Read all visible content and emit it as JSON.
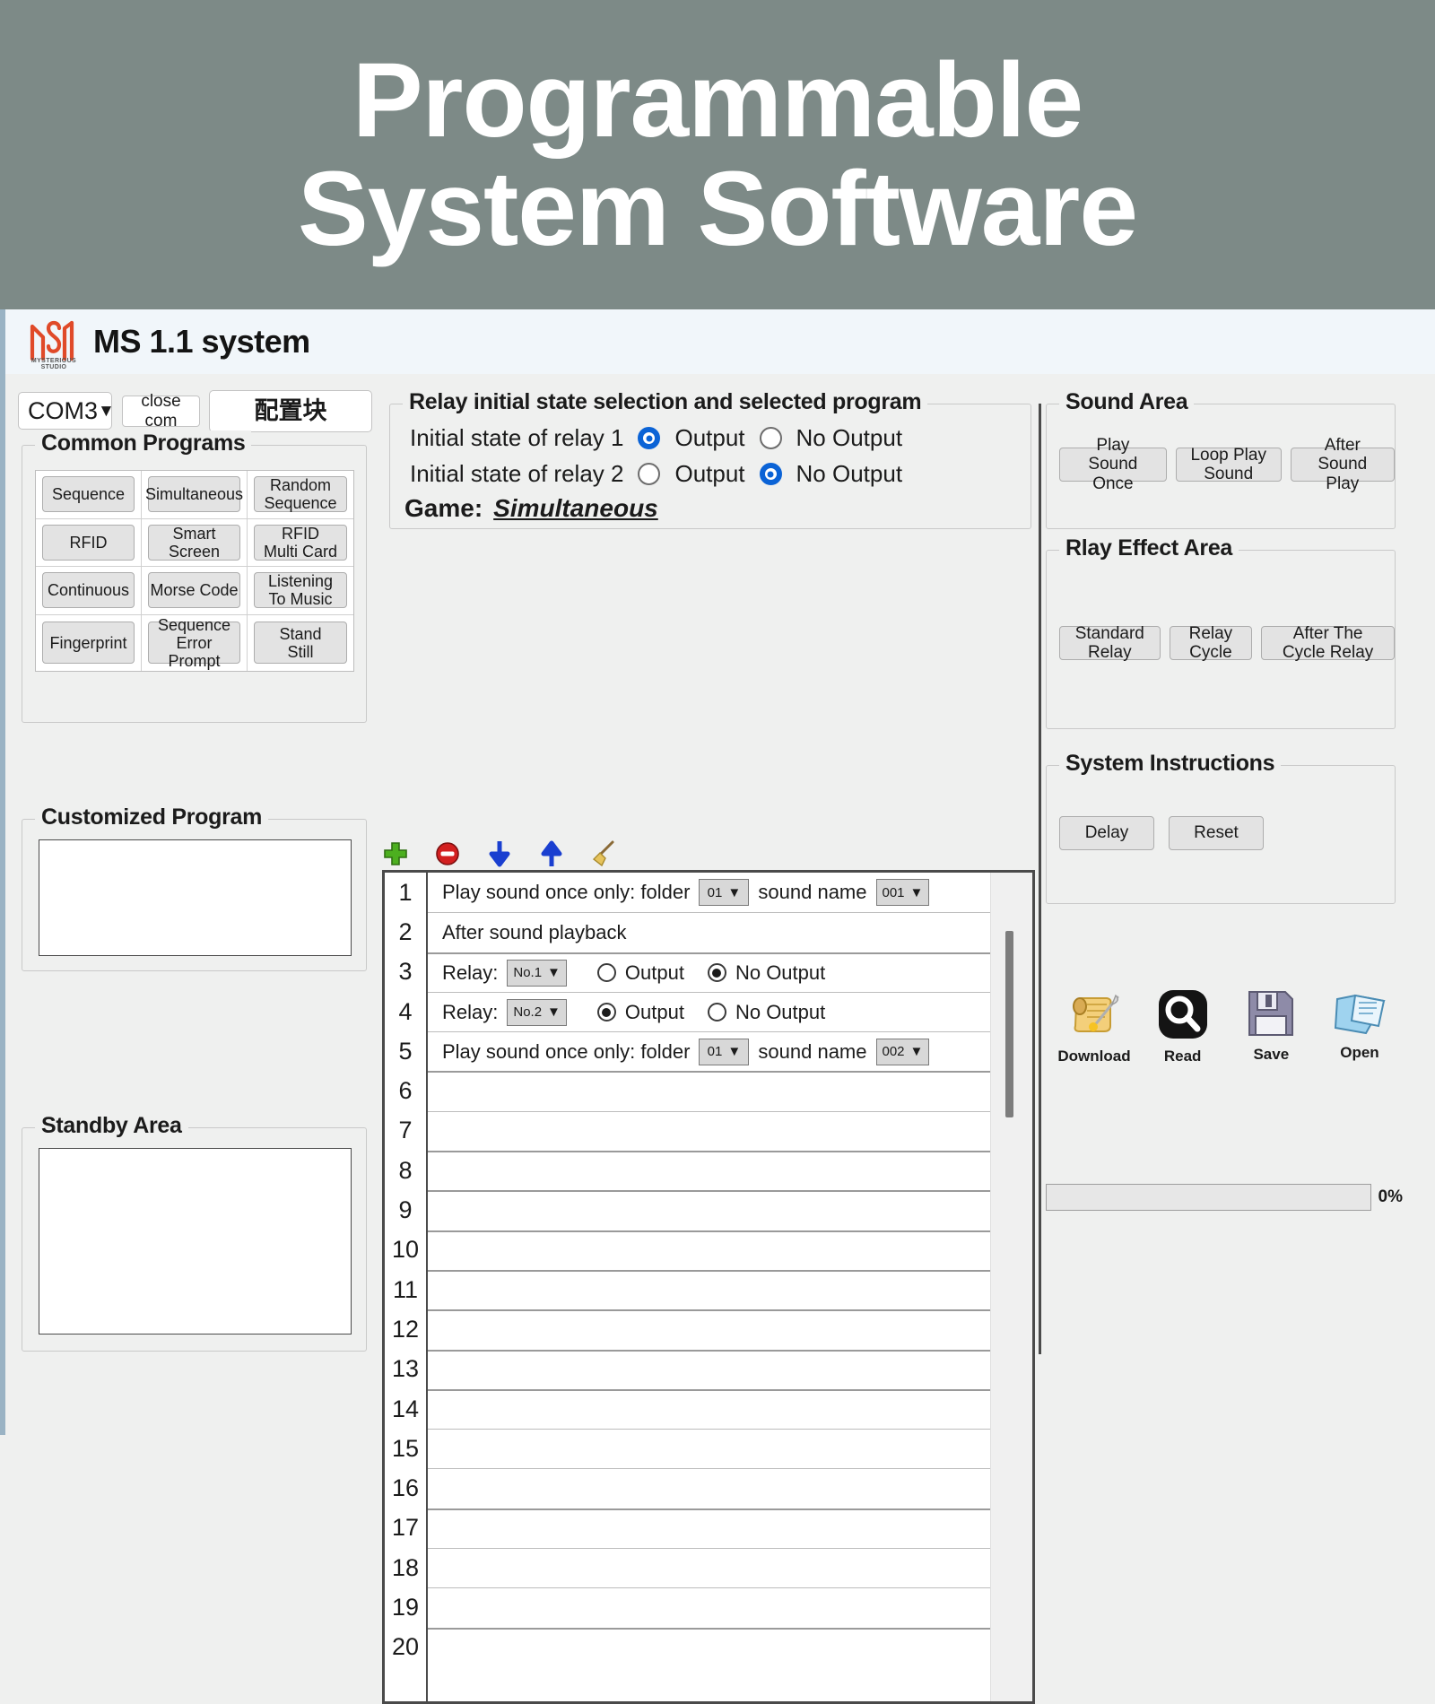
{
  "banner": {
    "line1": "Programmable",
    "line2": "System Software",
    "bg_color": "#7d8a87"
  },
  "titlebar": {
    "app_title": "MS 1.1 system",
    "logo_caption": "MYSTERIOUS STUDIO",
    "logo_color": "#e04a29"
  },
  "top_controls": {
    "com_port": "COM3",
    "com_caret": "▼",
    "close_com_label": "close com",
    "config_label": "配置块"
  },
  "common_programs": {
    "legend": "Common Programs",
    "buttons": [
      "Sequence",
      "Simultaneous",
      "Random\nSequence",
      "RFID",
      "Smart\nScreen",
      "RFID\nMulti Card",
      "Continuous",
      "Morse Code",
      "Listening\nTo Music",
      "Fingerprint",
      "Sequence\nError Prompt",
      "Stand\nStill"
    ]
  },
  "customized_program": {
    "legend": "Customized Program",
    "content": ""
  },
  "standby_area": {
    "legend": "Standby Area",
    "content": ""
  },
  "relay_init": {
    "legend": "Relay initial state selection and selected program",
    "relay1_label": "Initial state of relay 1",
    "relay2_label": "Initial state of relay 2",
    "output_label": "Output",
    "no_output_label": "No Output",
    "relay1_selected": "Output",
    "relay2_selected": "No Output",
    "game_label": "Game:",
    "game_value": "Simultaneous",
    "accent_color": "#0b63d6"
  },
  "toolbar": {
    "icons": [
      "add-icon",
      "remove-icon",
      "move-down-icon",
      "move-up-icon",
      "clear-broom-icon"
    ]
  },
  "program_list": {
    "row_numbers": [
      "1",
      "2",
      "3",
      "4",
      "5",
      "6",
      "7",
      "8",
      "9",
      "10",
      "11",
      "12",
      "13",
      "14",
      "15",
      "16",
      "17",
      "18",
      "19",
      "20"
    ],
    "rows": [
      {
        "type": "sound",
        "prefix": "Play sound once only: folder",
        "folder": "01",
        "mid": "sound name",
        "sound": "001"
      },
      {
        "type": "text",
        "text": "After sound playback"
      },
      {
        "type": "relay",
        "prefix": "Relay:",
        "relay_no": "No.1",
        "output_label": "Output",
        "no_output_label": "No Output",
        "selected": "No Output"
      },
      {
        "type": "relay",
        "prefix": "Relay:",
        "relay_no": "No.2",
        "output_label": "Output",
        "no_output_label": "No Output",
        "selected": "Output"
      },
      {
        "type": "sound",
        "prefix": "Play sound once only: folder",
        "folder": "01",
        "mid": "sound name",
        "sound": "002"
      },
      {
        "type": "empty"
      },
      {
        "type": "empty"
      },
      {
        "type": "empty"
      },
      {
        "type": "empty"
      },
      {
        "type": "empty"
      },
      {
        "type": "empty"
      },
      {
        "type": "empty"
      },
      {
        "type": "empty"
      },
      {
        "type": "empty"
      },
      {
        "type": "empty"
      },
      {
        "type": "empty"
      },
      {
        "type": "empty"
      },
      {
        "type": "empty"
      },
      {
        "type": "empty"
      },
      {
        "type": "empty"
      }
    ]
  },
  "sound_area": {
    "legend": "Sound Area",
    "buttons": [
      "Play Sound Once",
      "Loop Play Sound",
      "After Sound Play"
    ]
  },
  "relay_effect_area": {
    "legend": "Rlay Effect Area",
    "buttons": [
      "Standard Relay",
      "Relay Cycle",
      "After The Cycle Relay"
    ]
  },
  "system_instructions": {
    "legend": "System Instructions",
    "buttons": [
      "Delay",
      "Reset"
    ]
  },
  "actions": [
    {
      "label": "Download",
      "icon": "scroll-quill-icon"
    },
    {
      "label": "Read",
      "icon": "magnifier-icon"
    },
    {
      "label": "Save",
      "icon": "floppy-disk-icon"
    },
    {
      "label": "Open",
      "icon": "open-folder-icon"
    }
  ],
  "progress": {
    "percent_label": "0%",
    "value": 0
  }
}
